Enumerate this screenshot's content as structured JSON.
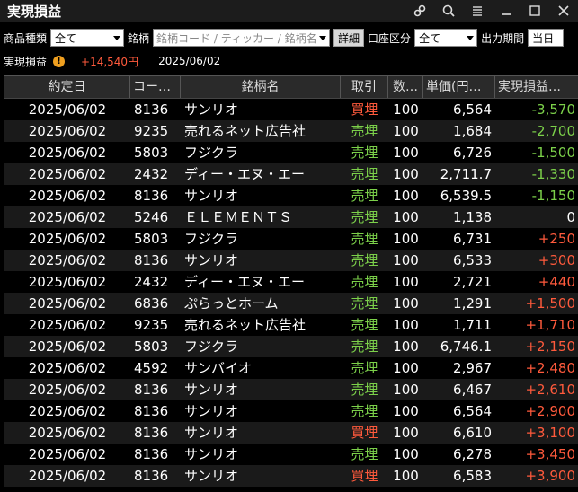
{
  "window": {
    "title": "実現損益"
  },
  "filters": {
    "product_label": "商品種類",
    "product_value": "全て",
    "symbol_label": "銘柄",
    "symbol_placeholder": "銘柄コード / ティッカー / 銘柄名",
    "detail_button": "詳細",
    "account_label": "口座区分",
    "account_value": "全て",
    "period_label": "出力期間",
    "period_value": "当日"
  },
  "summary": {
    "label": "実現損益",
    "total": "+14,540円",
    "date": "2025/06/02"
  },
  "table": {
    "headers": [
      "約定日",
      "コード…",
      "銘柄名",
      "取引",
      "数…",
      "単価(円…",
      "実現損益…"
    ],
    "rows": [
      {
        "date": "2025/06/02",
        "code": "8136",
        "name": "サンリオ",
        "trade": "買埋",
        "qty": "100",
        "price": "6,564",
        "pl": "-3,570"
      },
      {
        "date": "2025/06/02",
        "code": "9235",
        "name": "売れるネット広告社",
        "trade": "売埋",
        "qty": "100",
        "price": "1,684",
        "pl": "-2,700"
      },
      {
        "date": "2025/06/02",
        "code": "5803",
        "name": "フジクラ",
        "trade": "売埋",
        "qty": "100",
        "price": "6,726",
        "pl": "-1,500"
      },
      {
        "date": "2025/06/02",
        "code": "2432",
        "name": "ディー・エヌ・エー",
        "trade": "売埋",
        "qty": "100",
        "price": "2,711.7",
        "pl": "-1,330"
      },
      {
        "date": "2025/06/02",
        "code": "8136",
        "name": "サンリオ",
        "trade": "売埋",
        "qty": "100",
        "price": "6,539.5",
        "pl": "-1,150"
      },
      {
        "date": "2025/06/02",
        "code": "5246",
        "name": "ＥＬＥＭＥＮＴＳ",
        "trade": "売埋",
        "qty": "100",
        "price": "1,138",
        "pl": "0"
      },
      {
        "date": "2025/06/02",
        "code": "5803",
        "name": "フジクラ",
        "trade": "売埋",
        "qty": "100",
        "price": "6,731",
        "pl": "+250"
      },
      {
        "date": "2025/06/02",
        "code": "8136",
        "name": "サンリオ",
        "trade": "売埋",
        "qty": "100",
        "price": "6,533",
        "pl": "+300"
      },
      {
        "date": "2025/06/02",
        "code": "2432",
        "name": "ディー・エヌ・エー",
        "trade": "売埋",
        "qty": "100",
        "price": "2,721",
        "pl": "+440"
      },
      {
        "date": "2025/06/02",
        "code": "6836",
        "name": "ぷらっとホーム",
        "trade": "売埋",
        "qty": "100",
        "price": "1,291",
        "pl": "+1,500"
      },
      {
        "date": "2025/06/02",
        "code": "9235",
        "name": "売れるネット広告社",
        "trade": "売埋",
        "qty": "100",
        "price": "1,711",
        "pl": "+1,710"
      },
      {
        "date": "2025/06/02",
        "code": "5803",
        "name": "フジクラ",
        "trade": "売埋",
        "qty": "100",
        "price": "6,746.1",
        "pl": "+2,150"
      },
      {
        "date": "2025/06/02",
        "code": "4592",
        "name": "サンバイオ",
        "trade": "売埋",
        "qty": "100",
        "price": "2,967",
        "pl": "+2,480"
      },
      {
        "date": "2025/06/02",
        "code": "8136",
        "name": "サンリオ",
        "trade": "売埋",
        "qty": "100",
        "price": "6,467",
        "pl": "+2,610"
      },
      {
        "date": "2025/06/02",
        "code": "8136",
        "name": "サンリオ",
        "trade": "売埋",
        "qty": "100",
        "price": "6,564",
        "pl": "+2,900"
      },
      {
        "date": "2025/06/02",
        "code": "8136",
        "name": "サンリオ",
        "trade": "買埋",
        "qty": "100",
        "price": "6,610",
        "pl": "+3,100"
      },
      {
        "date": "2025/06/02",
        "code": "8136",
        "name": "サンリオ",
        "trade": "売埋",
        "qty": "100",
        "price": "6,278",
        "pl": "+3,450"
      },
      {
        "date": "2025/06/02",
        "code": "8136",
        "name": "サンリオ",
        "trade": "買埋",
        "qty": "100",
        "price": "6,583",
        "pl": "+3,900"
      }
    ]
  },
  "colors": {
    "positive": "#ff5a3c",
    "negative": "#7cd14a",
    "buy": "#ff5a3c",
    "sell": "#7cd14a"
  }
}
